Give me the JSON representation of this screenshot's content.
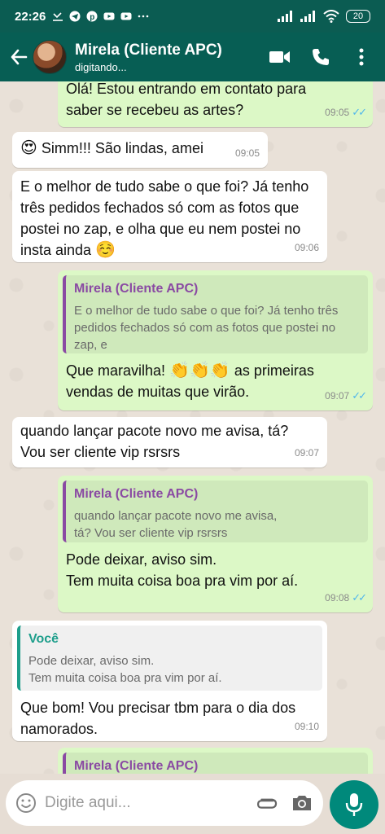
{
  "status_bar": {
    "time": "22:26",
    "battery": "20"
  },
  "header": {
    "contact_name": "Mirela (Cliente APC)",
    "contact_status": "digitando..."
  },
  "messages": [
    {
      "dir": "out",
      "text": "Olá! Estou entrando em contato para saber se recebeu as artes?",
      "time": "09:05"
    },
    {
      "dir": "in",
      "emoji": "😍",
      "text": "Simm!!! São lindas, amei",
      "time": "09:05"
    },
    {
      "dir": "in",
      "text": "E o melhor de tudo sabe o que foi? Já tenho três pedidos fechados só com as fotos que postei no zap, e olha que eu nem postei no insta ainda",
      "emoji_end": "☺️",
      "time": "09:06"
    },
    {
      "dir": "out",
      "quote_name": "Mirela (Cliente APC)",
      "quote_text": "E o melhor de tudo sabe o que foi? Já tenho três pedidos fechados só com as fotos que postei no zap, e",
      "text_before": "Que maravilha!",
      "emoji_mid": "👏👏👏",
      "text_after": "as primeiras vendas de muitas que virão.",
      "time": "09:07"
    },
    {
      "dir": "in",
      "text": "quando lançar pacote novo me avisa, tá? Vou ser cliente vip rsrsrs",
      "time": "09:07"
    },
    {
      "dir": "out",
      "quote_name": "Mirela (Cliente APC)",
      "quote_text": "quando lançar pacote novo me avisa, tá? Vou ser cliente vip rsrsrs",
      "line1": "Pode deixar, aviso sim.",
      "line2": "Tem muita coisa boa pra vim por aí.",
      "time": "09:08"
    },
    {
      "dir": "in",
      "quote_name": "Você",
      "quote_line1": "Pode deixar, aviso sim.",
      "quote_line2": "Tem muita coisa boa pra vim por aí.",
      "text": "Que bom! Vou precisar tbm para o dia dos namorados.",
      "time": "09:10"
    },
    {
      "dir": "out",
      "quote_name": "Mirela (Cliente APC)"
    }
  ],
  "input": {
    "placeholder": "Digite aqui..."
  }
}
